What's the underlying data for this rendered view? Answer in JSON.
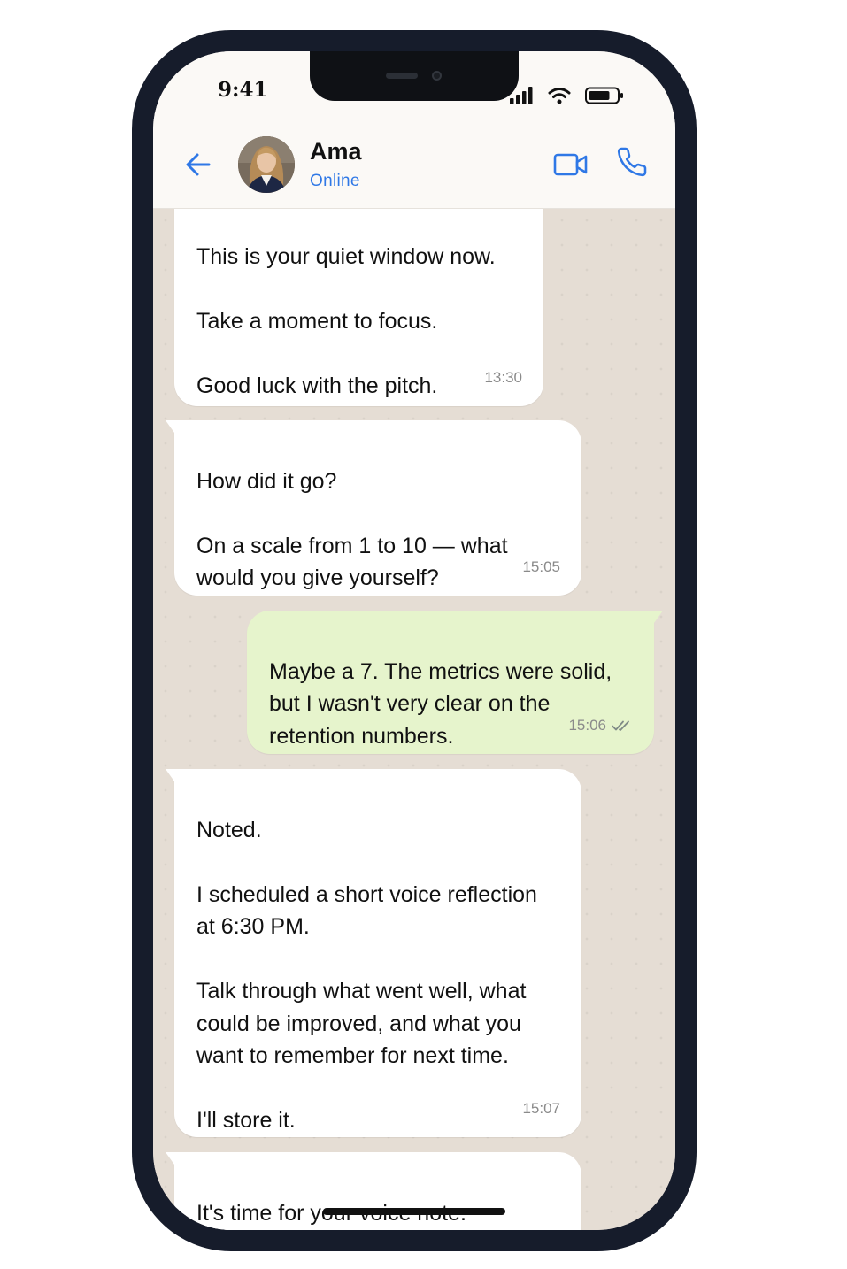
{
  "status_bar": {
    "time": "9:41",
    "icons": [
      "signal-icon",
      "wifi-icon",
      "battery-icon"
    ]
  },
  "header": {
    "contact_name": "Ama",
    "contact_status": "Online",
    "actions": [
      "back-arrow-icon",
      "video-call-icon",
      "phone-call-icon"
    ],
    "accent_color": "#2f78e6"
  },
  "messages": [
    {
      "direction": "incoming",
      "text": "This is your quiet window now.\n\nTake a moment to focus.\n\nGood luck with the pitch.",
      "time": "13:30"
    },
    {
      "direction": "incoming",
      "text": "How did it go?\n\nOn a scale from 1 to 10 — what would you give yourself?",
      "time": "15:05"
    },
    {
      "direction": "outgoing",
      "text": "Maybe a 7. The metrics were solid, but I wasn't very clear on the retention numbers.",
      "time": "15:06",
      "receipt": "double-check-icon"
    },
    {
      "direction": "incoming",
      "text": "Noted.\n\nI scheduled a short voice reflection at 6:30 PM.\n\nTalk through what went well, what could be improved, and what you want to remember for next time.\n\nI'll store it.",
      "time": "15:07"
    },
    {
      "direction": "incoming",
      "text": "It's time for your voice note.",
      "time": ""
    }
  ],
  "colors": {
    "incoming_bubble": "#ffffff",
    "outgoing_bubble": "#e6f4cc",
    "chat_background": "#e5ddd4",
    "phone_frame": "#161c2b"
  }
}
